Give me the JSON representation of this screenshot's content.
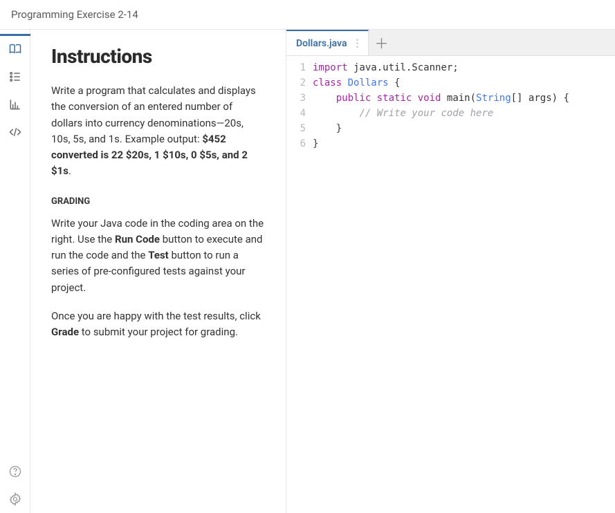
{
  "header": {
    "title": "Programming Exercise 2-14"
  },
  "sidebar": {
    "buttons": [
      {
        "name": "book-icon",
        "active": true
      },
      {
        "name": "list-icon",
        "active": false
      },
      {
        "name": "chart-icon",
        "active": false
      },
      {
        "name": "code-icon",
        "active": false
      }
    ],
    "bottom": [
      {
        "name": "help-icon"
      },
      {
        "name": "gear-icon"
      }
    ]
  },
  "instructions": {
    "heading": "Instructions",
    "para1_pre": "Write a program that calculates and displays the conversion of an entered number of dollars into currency denominations—20s, 10s, 5s, and 1s. Example output: ",
    "para1_bold": "$452 converted is 22 $20s, 1 $10s, 0 $5s, and 2 $1s",
    "para1_post": ".",
    "section_label": "GRADING",
    "para2_a": "Write your Java code in the coding area on the right. Use the ",
    "para2_b": "Run Code",
    "para2_c": " button to execute and run the code and the ",
    "para2_d": "Test",
    "para2_e": " button to run a series of pre-configured tests against your project.",
    "para3_a": "Once you are happy with the test results, click ",
    "para3_b": "Grade",
    "para3_c": " to submit your project for grading."
  },
  "editor": {
    "tab_name": "Dollars.java",
    "code": {
      "line1": {
        "kw1": "import",
        "pkg": " java.util.Scanner;"
      },
      "line2": {
        "kw1": "class",
        "ident": " Dollars ",
        "br": "{"
      },
      "line3": {
        "indent": "    ",
        "kw1": "public",
        "sp1": " ",
        "kw2": "static",
        "sp2": " ",
        "kw3": "void",
        "fn": " main(",
        "type": "String",
        "rest": "[] args) {"
      },
      "line4": {
        "indent": "        ",
        "comment": "// Write your code here"
      },
      "line5": {
        "indent": "    ",
        "br": "}"
      },
      "line6": {
        "br": "}"
      },
      "line_numbers": [
        "1",
        "2",
        "3",
        "4",
        "5",
        "6"
      ]
    }
  }
}
